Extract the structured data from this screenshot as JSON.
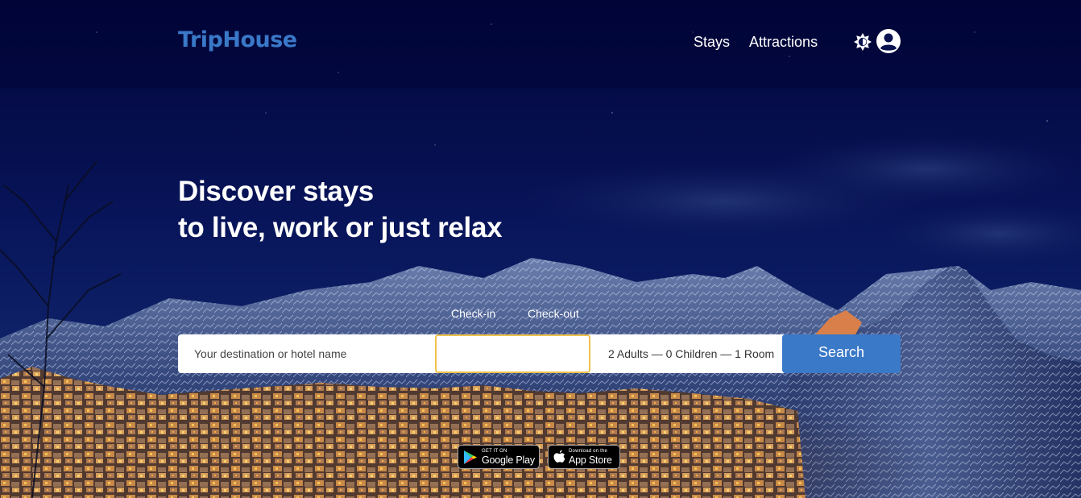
{
  "brand": {
    "logo_text": "TripHouse",
    "accent_color": "#3a78c8"
  },
  "nav": {
    "items": [
      {
        "label": "Stays"
      },
      {
        "label": "Attractions"
      }
    ],
    "icons": [
      "brightness-icon",
      "account-circle-icon"
    ]
  },
  "hero": {
    "headline_line1": "Discover stays",
    "headline_line2": "to live, work or just relax",
    "background": "night-mountain-village-photo"
  },
  "search": {
    "checkin_label": "Check-in",
    "checkout_label": "Check-out",
    "destination_placeholder": "Your destination or hotel name",
    "destination_value": "",
    "date_value": "",
    "guests_text": "2 Adults — 0 Children — 1 Room",
    "button_label": "Search",
    "focused_field_border_color": "#f0c14b"
  },
  "app_badges": {
    "google": {
      "small": "GET IT ON",
      "big": "Google Play"
    },
    "apple": {
      "small": "Download on the",
      "big": "App Store"
    }
  }
}
